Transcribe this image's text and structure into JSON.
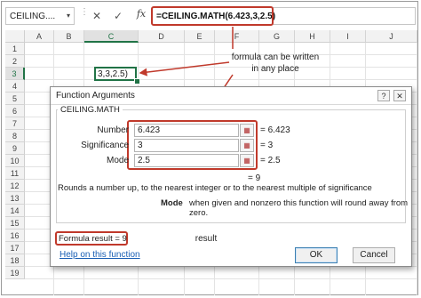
{
  "formula_bar": {
    "name_box": "CEILING....",
    "name_box_dropdown_icon": "chevron-down-icon",
    "cancel_icon": "✕",
    "enter_icon": "✓",
    "fx_label": "fx",
    "formula": "=CEILING.MATH(6.423,3,2.5)"
  },
  "grid": {
    "columns": [
      "A",
      "B",
      "C",
      "D",
      "E",
      "F",
      "G",
      "H",
      "I",
      "J"
    ],
    "selected_column": "C",
    "rows": [
      "1",
      "2",
      "3",
      "4",
      "5",
      "6",
      "7",
      "8",
      "9",
      "10",
      "11",
      "12",
      "13",
      "14",
      "15",
      "16",
      "17",
      "18",
      "19"
    ],
    "selected_row": "3",
    "active_cell_text": "3,3,2.5)"
  },
  "annotations": {
    "formula_note": "formula can be written in any place",
    "result_note": "result",
    "highlight_color": "#c0392b"
  },
  "dialog": {
    "title": "Function Arguments",
    "help_icon": "?",
    "close_icon": "✕",
    "function_name": "CEILING.MATH",
    "args": [
      {
        "label": "Number",
        "value": "6.423",
        "evaluated": "= 6.423"
      },
      {
        "label": "Significance",
        "value": "3",
        "evaluated": "= 3"
      },
      {
        "label": "Mode",
        "value": "2.5",
        "evaluated": "= 2.5"
      }
    ],
    "result_line": "= 9",
    "description": "Rounds a number up, to the nearest integer or to the nearest multiple of significance",
    "mode_label": "Mode",
    "mode_description": "when given and nonzero this function will round away from zero.",
    "formula_result": "Formula result = 9",
    "help_link": "Help on this function",
    "ok_label": "OK",
    "cancel_label": "Cancel"
  }
}
